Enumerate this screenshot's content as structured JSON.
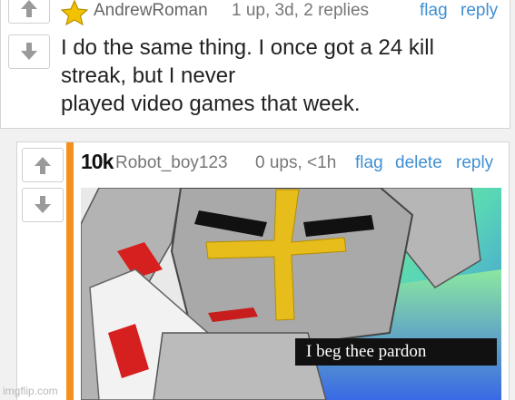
{
  "comment1": {
    "username": "AndrewRoman",
    "meta": "1 up, 3d, 2 replies",
    "flag_label": "flag",
    "reply_label": "reply",
    "body_lines": [
      "I do the same thing. I once got a 24 kill",
      "streak, but I never",
      "played video games that week."
    ]
  },
  "comment2": {
    "points": "10k",
    "username": "Robot_boy123",
    "meta": "0 ups, <1h",
    "flag_label": "flag",
    "delete_label": "delete",
    "reply_label": "reply",
    "meme_caption": "I beg thee pardon"
  },
  "watermark": "imgflip.com",
  "colors": {
    "link": "#3f8fd2",
    "reply_bar": "#f4901e",
    "star": "#f2c200"
  },
  "icons": [
    "star-icon",
    "upvote-arrow-icon",
    "downvote-arrow-icon"
  ]
}
